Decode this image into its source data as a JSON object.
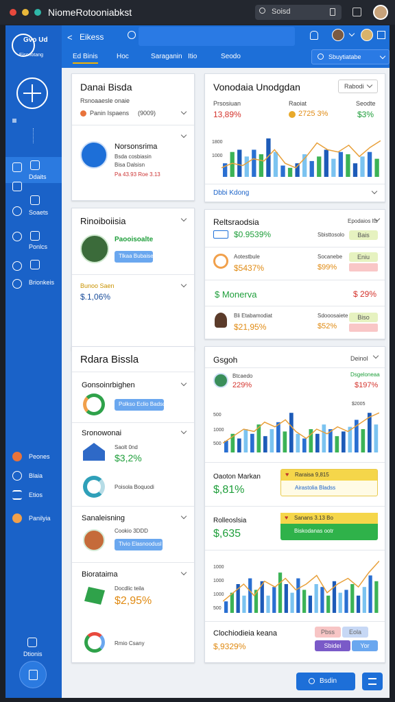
{
  "window": {
    "title": "NiomeRotooniabkst",
    "search_label": "Soisd"
  },
  "sidebar": {
    "logo_text": "Gvo Ud",
    "logo_sub": "Eisonotang",
    "items": [
      "Ddaits",
      "Soaets",
      "Ponlcs",
      "Brionkeis",
      "Peones",
      "Blaia",
      "Etios",
      "Panilyia"
    ],
    "bottom_label": "Dtionis"
  },
  "topbar": {
    "back_label": "Eikess",
    "tabs": [
      "Ed Binis",
      "Hoc",
      "Saraganin",
      "Itio",
      "Seodo"
    ],
    "search_label": "Sbuytiatabe"
  },
  "card1": {
    "title": "Danai Bisda",
    "subtitle": "Rsnoaaesle onaie",
    "row_label": "Panin Ispaens",
    "row_value": "(9009)",
    "profile_name": "Norsonsrima",
    "profile_sub1": "Bsda cosbiasin",
    "profile_sub2": "Bisa Dalsisn",
    "profile_meta": "Pa 43.93 Roe 3.13"
  },
  "card2": {
    "title": "Rinoiboiisia",
    "profile_name": "Paooisoalte",
    "button": "Tlkaa Bubaise",
    "sub_label": "Bunoo Saen",
    "sub_value": "$.1,06%"
  },
  "card3": {
    "title": "Rdara Bissla",
    "sections": [
      {
        "title": "Gonsoinrbighen",
        "button": "Polkso Eclio Badsde"
      },
      {
        "title": "Sronowonai",
        "sub": "Saolt 0nd",
        "value": "$3,2%",
        "donut_label": "Poisola Boquodi"
      },
      {
        "title": "Sanaleisning",
        "sub": "Cookio 3DDD",
        "button": "Tlvio Elasnoodusl"
      },
      {
        "title": "Biorataima",
        "sub": "Docdlic teila",
        "value": "$2,95%",
        "donut_label": "Rmio Csany"
      }
    ]
  },
  "card4": {
    "title": "Vonodaia Unodgdan",
    "button": "Rabodi",
    "metrics": [
      {
        "label": "Prsosiuan",
        "value": "13,89%"
      },
      {
        "label": "Raoiat",
        "value": "2725 3%"
      },
      {
        "label": "Seodte",
        "value": "$3%"
      }
    ],
    "axis": [
      "1800",
      "1000"
    ],
    "footer": "Dbbi Kdong"
  },
  "card5": {
    "title": "Reltsraodsia",
    "right_label": "Epodaios lts",
    "rows": [
      {
        "value": "$0.9539%",
        "label": "Sbisttosolo",
        "badge": "Bais"
      },
      {
        "label": "Aotestbule",
        "value": "$5437%",
        "label2": "Socanebe",
        "value2": "$99%",
        "badge": "Eniu"
      },
      {
        "value": "$  Monerva",
        "value2": "$ 29%"
      },
      {
        "label": "Bli Etabamodiat",
        "value": "$21,95%",
        "label2": "Sdooosaiete",
        "value2": "$52%",
        "badge": "Biso"
      }
    ]
  },
  "card6": {
    "title": "Gsgoh",
    "right_label": "Deinol",
    "metric_label": "Btcaedo",
    "metric_value": "229%",
    "metric2_label": "Dsgeloneaa",
    "metric2_value": "$197%",
    "chart1_top": "$2005",
    "axis1": [
      "500",
      "1000",
      "500"
    ],
    "rows": [
      {
        "label": "Oaoton Markan",
        "value": "$,81%",
        "banner": "Raraisa 9,815",
        "banner_sub": "Airastolia Bladss"
      },
      {
        "label": "Rolleoslsia",
        "value": "$,635",
        "banner": "Sanans 3.13 Bo",
        "banner_sub": "Biskodanas ootr"
      }
    ],
    "axis2": [
      "1000",
      "1000",
      "1000",
      "500"
    ],
    "footer_label": "Clochiodieia keana",
    "footer_value": "$,9329%",
    "pills": [
      "Pbss",
      "Eola",
      "Sbidei",
      "Yor"
    ]
  },
  "fab": {
    "label": "Bsdin"
  }
}
